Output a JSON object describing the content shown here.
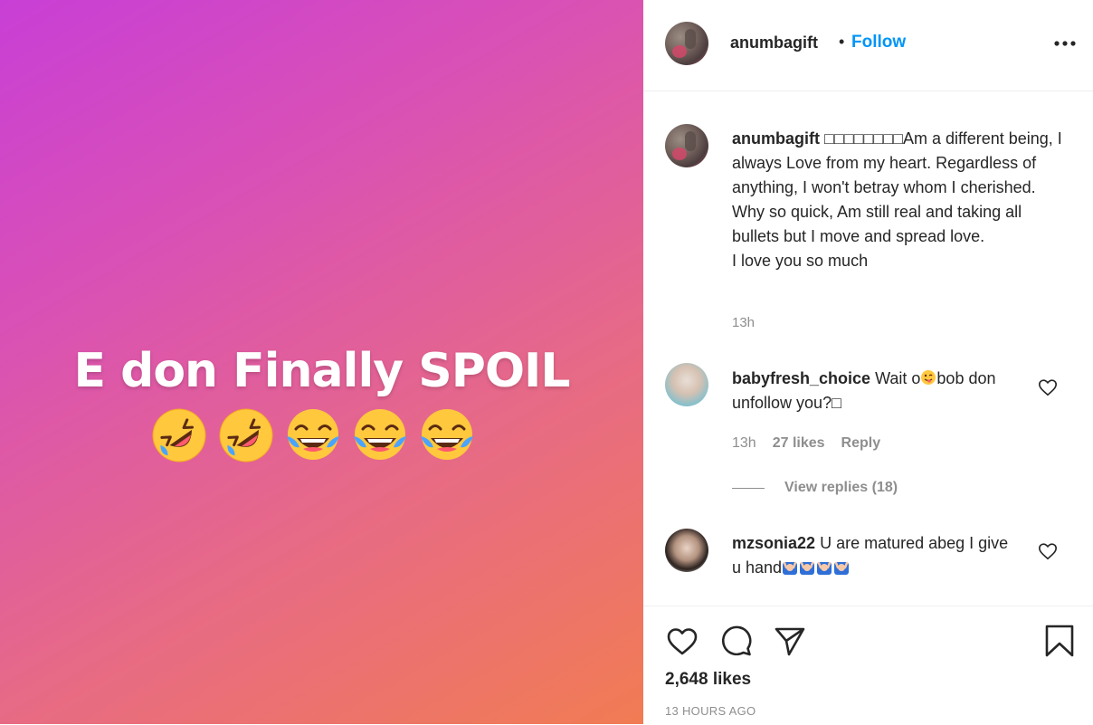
{
  "post": {
    "text": "E don Finally SPOIL",
    "emojis": [
      "rolling-on-floor-laughing",
      "rolling-on-floor-laughing",
      "tears-of-joy",
      "tears-of-joy",
      "tears-of-joy"
    ],
    "background_colors": [
      "#c83fd6",
      "#d950b6",
      "#e76a86",
      "#f17c53"
    ]
  },
  "header": {
    "username": "anumbagift",
    "separator": "•",
    "follow_label": "Follow",
    "more_icon": "more-horizontal-icon"
  },
  "caption": {
    "username": "anumbagift",
    "lines": [
      "□□□□□□□□Am a different being, I always Love from my heart. Regardless of anything, I won't betray whom I cherished.",
      "Why so quick, Am still real and taking all bullets but I move and spread love.",
      "I love you so much"
    ],
    "time": "13h"
  },
  "comments": [
    {
      "username": "babyfresh_choice",
      "text": "Wait o",
      "text_after_emoji": "bob don unfollow you?□",
      "time": "13h",
      "likes": "27 likes",
      "reply_label": "Reply",
      "view_replies": "View replies (18)"
    },
    {
      "username": "mzsonia22",
      "text": "U are matured abeg I give u hand",
      "emoji_count": 4
    }
  ],
  "footer": {
    "likes": "2,648 likes",
    "time_ago": "13 HOURS AGO"
  },
  "colors": {
    "accent": "#0095f6",
    "muted": "#8e8e8e",
    "text": "#262626"
  }
}
